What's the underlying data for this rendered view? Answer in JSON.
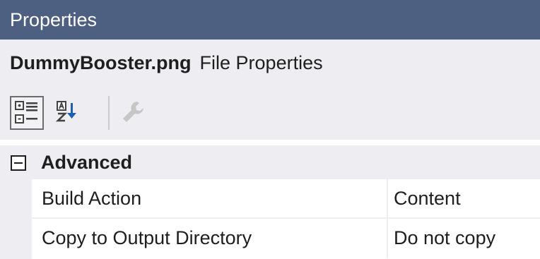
{
  "window": {
    "title": "Properties"
  },
  "object": {
    "name": "DummyBooster.png",
    "type": "File Properties"
  },
  "toolbar": {
    "buttons": [
      {
        "icon": "categorized-icon",
        "selected": true
      },
      {
        "icon": "alphabetical-sort-icon",
        "selected": false
      },
      {
        "icon": "wrench-icon",
        "selected": false,
        "enabled": false
      }
    ]
  },
  "grid": {
    "category": {
      "label": "Advanced",
      "expanded": true
    },
    "properties": [
      {
        "name": "Build Action",
        "value": "Content"
      },
      {
        "name": "Copy to Output Directory",
        "value": "Do not copy"
      }
    ]
  },
  "colors": {
    "titlebar": "#4d6082",
    "panel_background": "#eeeef2",
    "text": "#1e1e1e"
  }
}
